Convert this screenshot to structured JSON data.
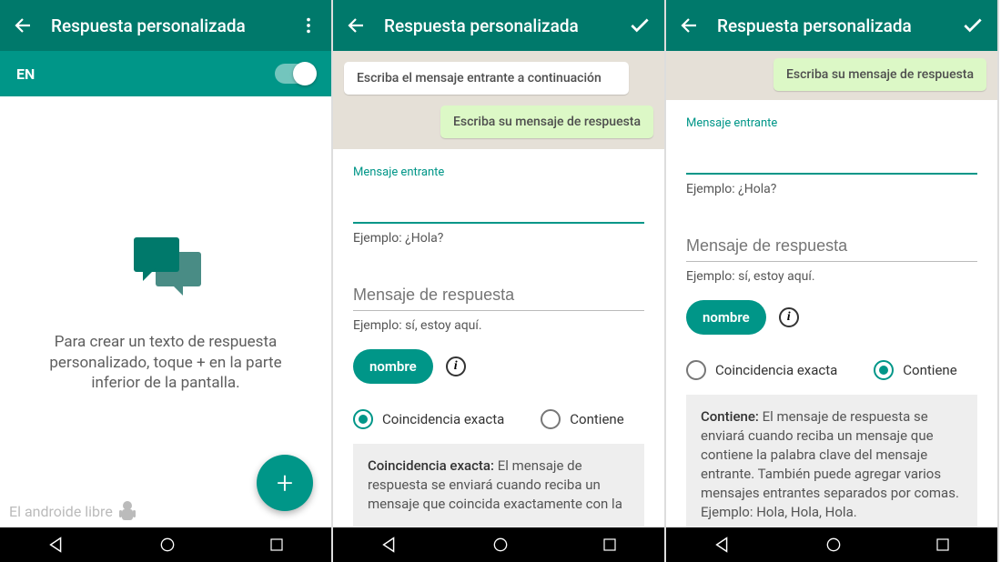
{
  "common": {
    "title": "Respuesta personalizada"
  },
  "pane1": {
    "lang_code": "EN",
    "empty_text": "Para crear un texto de respuesta personalizado, toque + en la parte inferior de la pantalla.",
    "watermark": "El androide libre",
    "fab_label": "+"
  },
  "form": {
    "incoming_hint_bubble": "Escriba el mensaje entrante a continuación",
    "reply_hint_bubble": "Escriba su mensaje de respuesta",
    "incoming_label": "Mensaje entrante",
    "incoming_example": "Ejemplo: ¿Hola?",
    "reply_placeholder": "Mensaje de respuesta",
    "reply_example": "Ejemplo: sí, estoy aquí.",
    "name_chip": "nombre",
    "option_exact": "Coincidencia exacta",
    "option_contains": "Contiene",
    "info_exact_lead": "Coincidencia exacta:",
    "info_exact_body": " El mensaje de respuesta se enviará cuando reciba un mensaje que coincida exactamente con la",
    "info_contains_lead": "Contiene:",
    "info_contains_body": " El mensaje de respuesta se enviará cuando reciba un mensaje que contiene la palabra clave del mensaje entrante. También puede agregar varios mensajes entrantes separados por comas. Ejemplo: Hola, Hola, Hola."
  }
}
